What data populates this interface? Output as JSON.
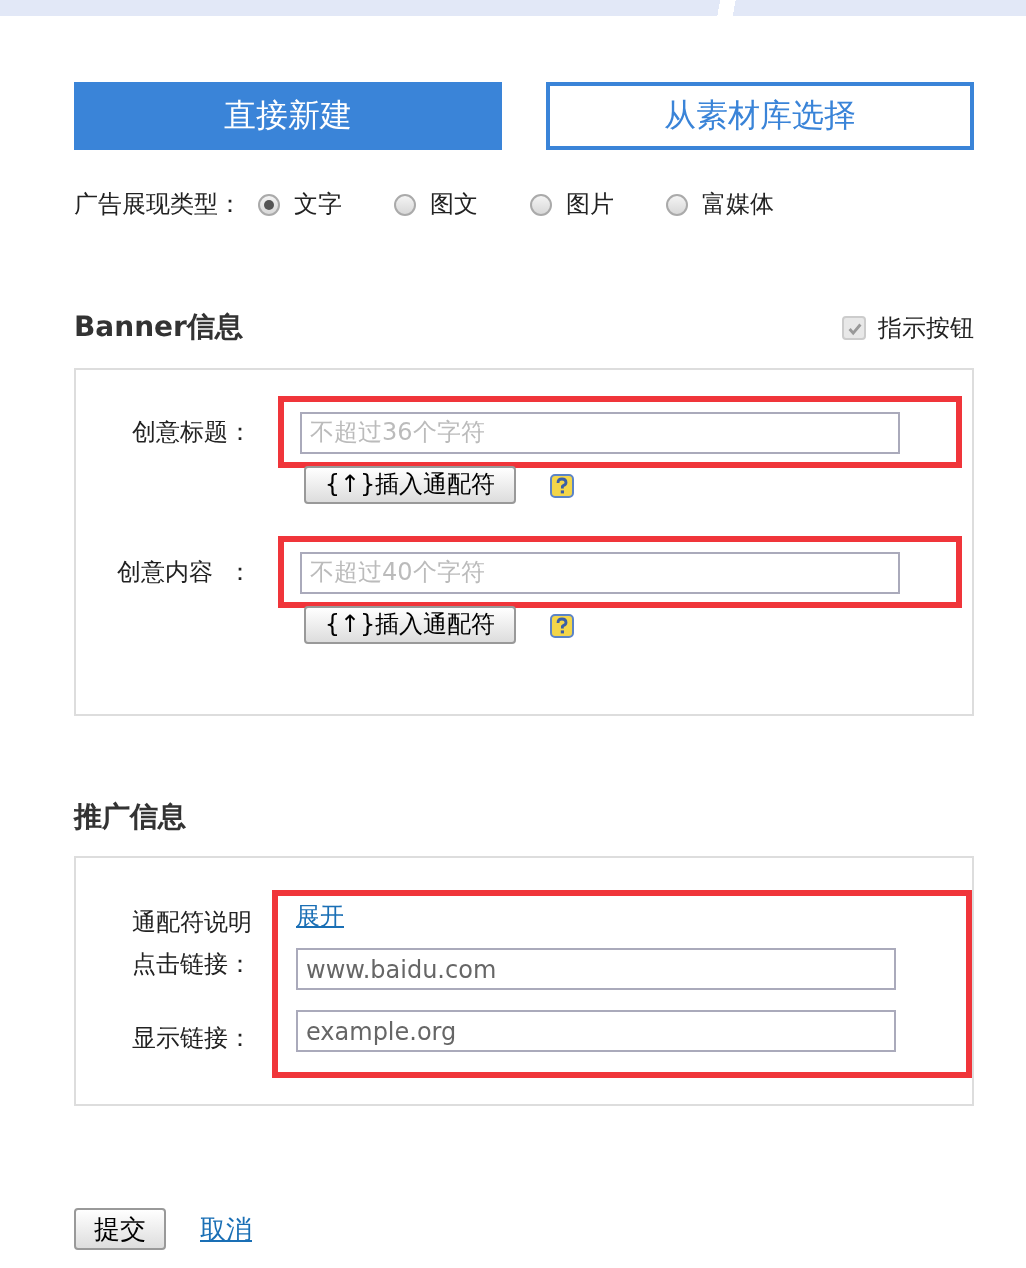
{
  "mode_buttons": [
    {
      "label": "直接新建",
      "selected": true
    },
    {
      "label": "从素材库选择",
      "selected": false
    }
  ],
  "ad_type": {
    "label": "广告展现类型：",
    "options": [
      {
        "label": "文字",
        "selected": true
      },
      {
        "label": "图文",
        "selected": false
      },
      {
        "label": "图片",
        "selected": false
      },
      {
        "label": "富媒体",
        "selected": false
      }
    ]
  },
  "banner_section": {
    "title": "Banner信息",
    "toggle": {
      "label": "指示按钮",
      "checked": true
    },
    "fields": [
      {
        "label": "创意标题：",
        "placeholder": "不超过36个字符",
        "highlighted": true,
        "insert_button": "{↑}插入通配符"
      },
      {
        "label": "创意内容  ：",
        "placeholder": "不超过40个字符",
        "highlighted": true,
        "insert_button": "{↑}插入通配符"
      }
    ]
  },
  "promo_section": {
    "title": "推广信息",
    "highlighted": true,
    "rows": [
      {
        "kind": "link",
        "label": "通配符说明",
        "link": "展开"
      },
      {
        "kind": "field",
        "label": "点击链接：",
        "value": "www.baidu.com"
      },
      {
        "kind": "field",
        "label": "显示链接：",
        "value": "example.org"
      }
    ]
  },
  "actions": {
    "submit": "提交",
    "cancel": "取消"
  }
}
